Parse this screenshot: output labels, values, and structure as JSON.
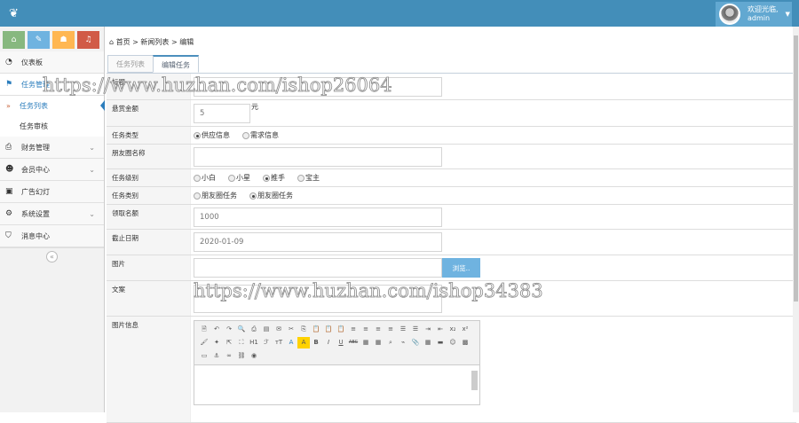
{
  "header": {
    "logo_icon": "leaf-icon",
    "welcome": "欢迎光临,",
    "username": "admin"
  },
  "shortcuts": [
    {
      "icon": "home-icon",
      "color": "#87b87f"
    },
    {
      "icon": "pencil-icon",
      "color": "#6fb3e0"
    },
    {
      "icon": "group-icon",
      "color": "#ffb752"
    },
    {
      "icon": "bell-icon",
      "color": "#d15b47"
    }
  ],
  "sidebar": {
    "items": [
      {
        "label": "仪表板",
        "icon": "dashboard-icon"
      },
      {
        "label": "任务管理",
        "icon": "flag-icon"
      },
      {
        "label": "财务管理",
        "icon": "printer-icon"
      },
      {
        "label": "会员中心",
        "icon": "user-icon"
      },
      {
        "label": "广告幻灯",
        "icon": "picture-icon"
      },
      {
        "label": "系统设置",
        "icon": "gear-icon"
      },
      {
        "label": "消息中心",
        "icon": "bookmark-icon"
      }
    ],
    "subitems": [
      "任务列表",
      "任务审核"
    ],
    "collapse": "«"
  },
  "breadcrumb": {
    "home": "首页",
    "sep": ">",
    "list": "新闻列表",
    "current": "编辑"
  },
  "tabs": [
    "任务列表",
    "编辑任务"
  ],
  "form": {
    "title_label": "标题",
    "title_value": "",
    "reward_label": "悬赏金额",
    "reward_value": "5",
    "reward_unit": "元",
    "type_label": "任务类型",
    "type_options": [
      "供应信息",
      "需求信息"
    ],
    "moments_label": "朋友圈名称",
    "moments_value": "",
    "level_label": "任务级别",
    "level_options": [
      "小白",
      "小星",
      "推手",
      "宝主"
    ],
    "category_label": "任务类别",
    "category_options": [
      "朋友圈任务",
      "朋友圈任务"
    ],
    "quota_label": "领取名额",
    "quota_value": "1000",
    "deadline_label": "截止日期",
    "deadline_value": "2020-01-09",
    "image_label": "图片",
    "browse": "浏览..",
    "copy_label": "文案",
    "imageinfo_label": "图片信息"
  },
  "editor": {
    "row3": [
      "H1",
      "ℱ",
      "тT",
      "A",
      "A",
      "B",
      "I",
      "U",
      "ABC"
    ]
  },
  "watermarks": [
    "https://www.huzhan.com/ishop26064",
    "https://www.huzhan.com/ishop34383"
  ]
}
